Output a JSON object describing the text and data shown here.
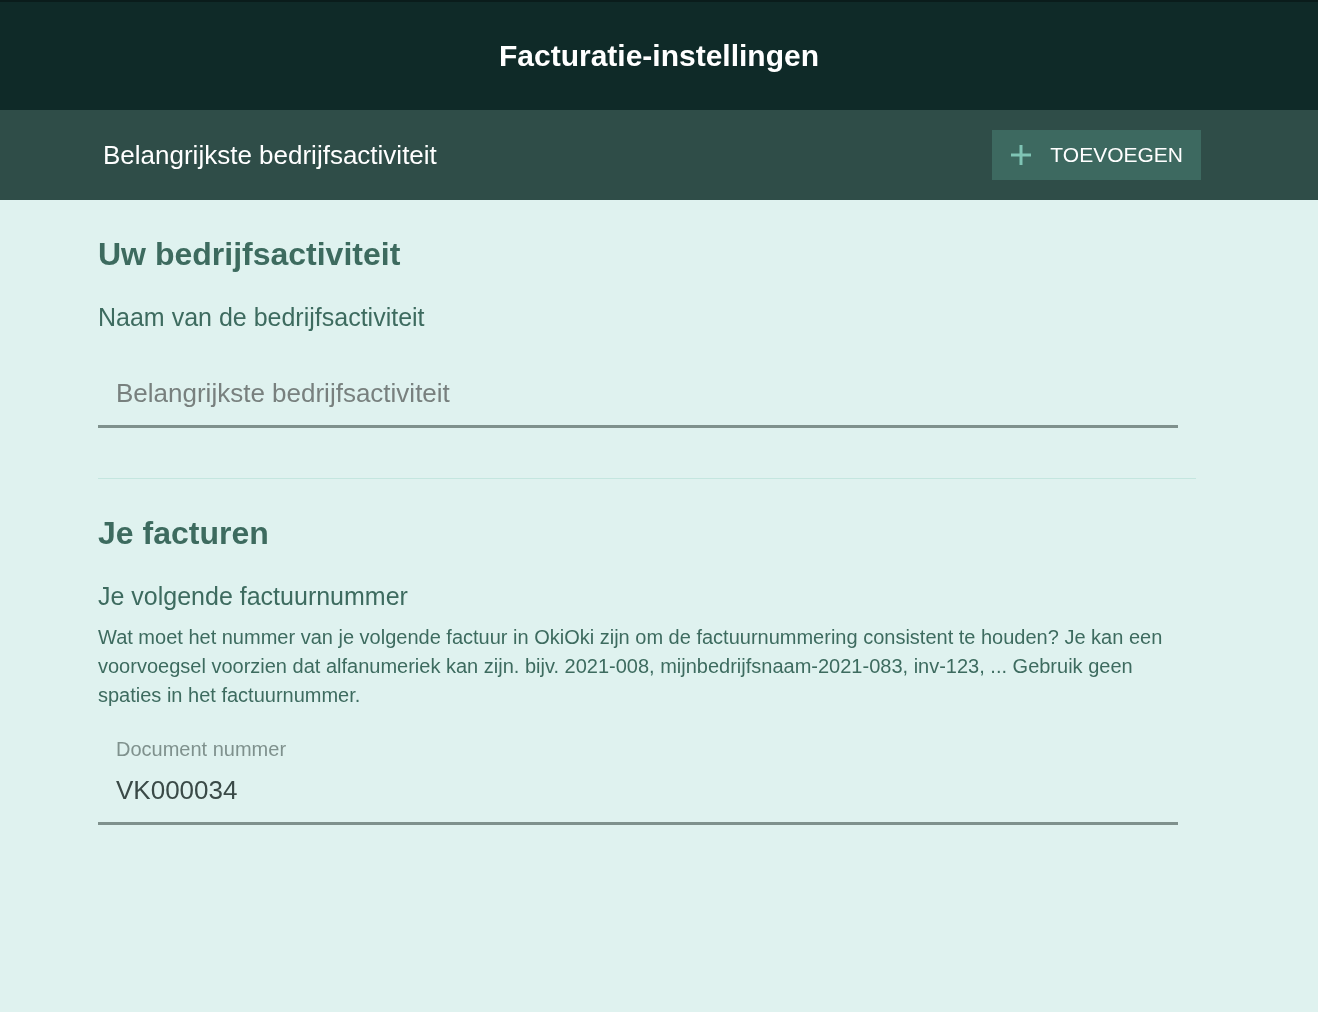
{
  "header": {
    "title": "Facturatie-instellingen"
  },
  "subheader": {
    "title": "Belangrijkste bedrijfsactiviteit",
    "add_button": {
      "label": "TOEVOEGEN"
    }
  },
  "sections": [
    {
      "heading": "Uw bedrijfsactiviteit",
      "field_label": "Naam van de bedrijfsactiviteit",
      "field": {
        "placeholder": "Belangrijkste bedrijfsactiviteit"
      }
    },
    {
      "heading": "Je facturen",
      "field_label": "Je volgende factuurnummer",
      "description": "Wat moet het nummer van je volgende factuur in OkiOki zijn om de factuurnummering consistent te houden? Je kan een voorvoegsel voorzien dat alfanumeriek kan zijn. bijv. 2021-008, mijnbedrijfsnaam-2021-083, inv-123, ... Gebruik geen spaties in het factuurnummer.",
      "field": {
        "label": "Document nummer",
        "value": "VK000034"
      }
    }
  ]
}
